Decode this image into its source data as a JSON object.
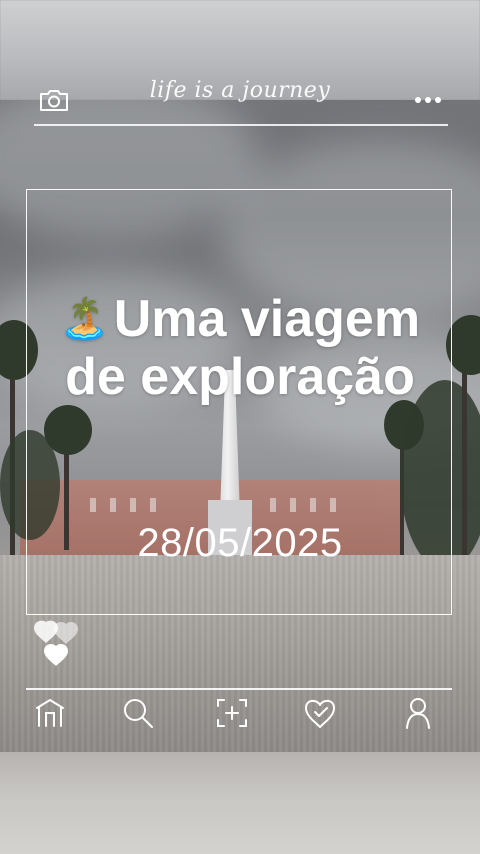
{
  "header": {
    "tagline": "life is a journey",
    "left_icon": "camera-icon",
    "right_icon": "more-dots-icon"
  },
  "title": {
    "emoji": "🏝️",
    "text": "Uma viagem de exploração"
  },
  "date": "28/05/2025",
  "hearts_icon": "hearts-icon",
  "nav": {
    "items": [
      {
        "icon": "home-icon"
      },
      {
        "icon": "search-icon"
      },
      {
        "icon": "add-icon"
      },
      {
        "icon": "heart-icon"
      },
      {
        "icon": "profile-icon"
      }
    ]
  },
  "colors": {
    "text": "#ffffff",
    "frame": "#ffffff"
  }
}
